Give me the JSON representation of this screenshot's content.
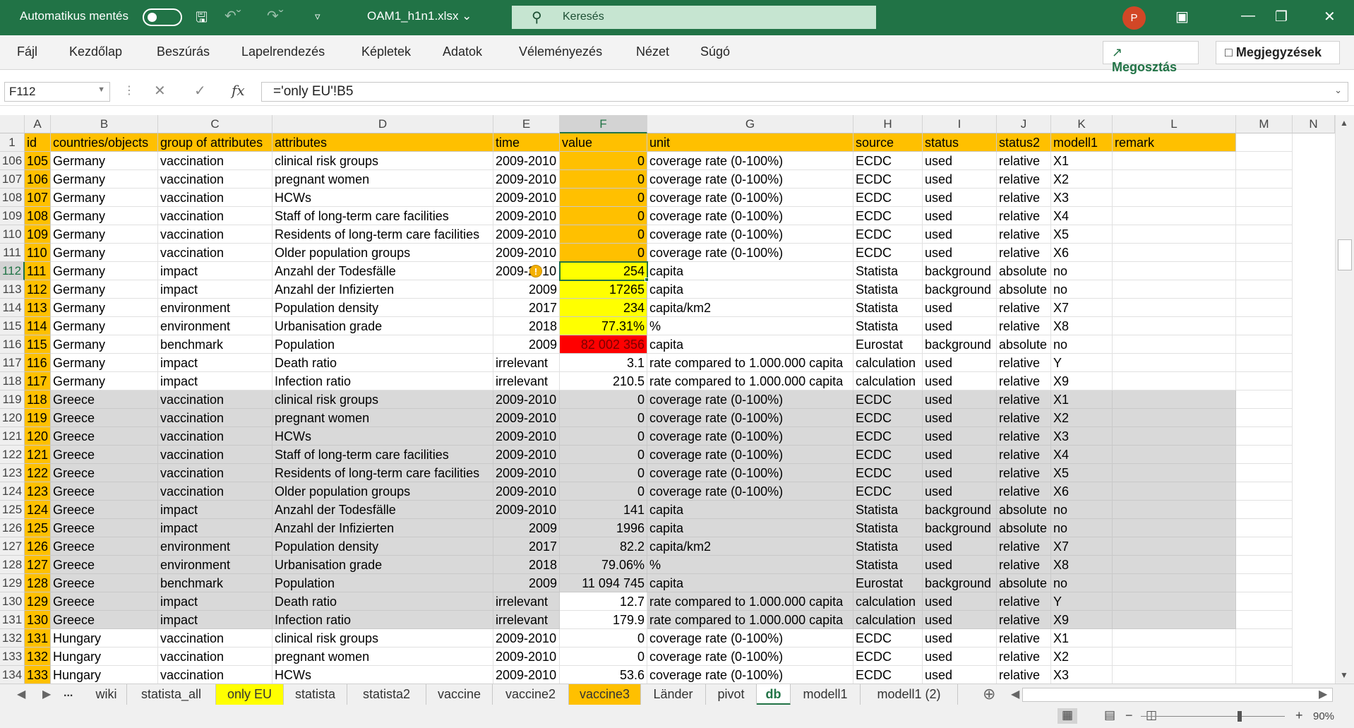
{
  "titlebar": {
    "autosave_label": "Automatikus mentés",
    "filename": "OAM1_h1n1.xlsx",
    "search_placeholder": "Keresés",
    "avatar_initial": "P"
  },
  "ribbon": {
    "tabs": [
      "Fájl",
      "Kezdőlap",
      "Beszúrás",
      "Lapelrendezés",
      "Képletek",
      "Adatok",
      "Véleményezés",
      "Nézet",
      "Súgó"
    ],
    "share_label": "Megosztás",
    "comments_label": "Megjegyzések"
  },
  "formula_bar": {
    "name_box": "F112",
    "formula": "='only EU'!B5"
  },
  "columns": [
    "A",
    "B",
    "C",
    "D",
    "E",
    "F",
    "G",
    "H",
    "I",
    "J",
    "K",
    "L",
    "M",
    "N"
  ],
  "selected_column": "F",
  "selected_row": "112",
  "header_row": {
    "row_number": "1",
    "cells": [
      "id",
      "countries/objects",
      "group of attributes",
      "attributes",
      "time",
      "value",
      "unit",
      "source",
      "status",
      "status2",
      "modell1",
      "remark"
    ]
  },
  "rows": [
    {
      "rn": "106",
      "id": "105",
      "country": "Germany",
      "group": "vaccination",
      "attr": "clinical risk groups",
      "time": "2009-2010",
      "value": "0",
      "unit": "coverage rate (0-100%)",
      "source": "ECDC",
      "status": "used",
      "status2": "relative",
      "modell1": "X1"
    },
    {
      "rn": "107",
      "id": "106",
      "country": "Germany",
      "group": "vaccination",
      "attr": "pregnant women",
      "time": "2009-2010",
      "value": "0",
      "unit": "coverage rate (0-100%)",
      "source": "ECDC",
      "status": "used",
      "status2": "relative",
      "modell1": "X2"
    },
    {
      "rn": "108",
      "id": "107",
      "country": "Germany",
      "group": "vaccination",
      "attr": "HCWs",
      "time": "2009-2010",
      "value": "0",
      "unit": "coverage rate (0-100%)",
      "source": "ECDC",
      "status": "used",
      "status2": "relative",
      "modell1": "X3"
    },
    {
      "rn": "109",
      "id": "108",
      "country": "Germany",
      "group": "vaccination",
      "attr": "Staff of long-term care facilities",
      "time": "2009-2010",
      "value": "0",
      "unit": "coverage rate (0-100%)",
      "source": "ECDC",
      "status": "used",
      "status2": "relative",
      "modell1": "X4"
    },
    {
      "rn": "110",
      "id": "109",
      "country": "Germany",
      "group": "vaccination",
      "attr": "Residents of long-term care facilities",
      "time": "2009-2010",
      "value": "0",
      "unit": "coverage rate (0-100%)",
      "source": "ECDC",
      "status": "used",
      "status2": "relative",
      "modell1": "X5"
    },
    {
      "rn": "111",
      "id": "110",
      "country": "Germany",
      "group": "vaccination",
      "attr": "Older population groups",
      "time": "2009-2010",
      "value": "0",
      "unit": "coverage rate (0-100%)",
      "source": "ECDC",
      "status": "used",
      "status2": "relative",
      "modell1": "X6"
    },
    {
      "rn": "112",
      "id": "111",
      "country": "Germany",
      "group": "impact",
      "attr": "Anzahl der Todesfälle",
      "time": "2009-2010",
      "value": "254",
      "unit": "capita",
      "source": "Statista",
      "status": "background",
      "status2": "absolute",
      "modell1": "no"
    },
    {
      "rn": "113",
      "id": "112",
      "country": "Germany",
      "group": "impact",
      "attr": "Anzahl der Infizierten",
      "time": "2009",
      "value": "17265",
      "unit": "capita",
      "source": "Statista",
      "status": "background",
      "status2": "absolute",
      "modell1": "no"
    },
    {
      "rn": "114",
      "id": "113",
      "country": "Germany",
      "group": "environment",
      "attr": "Population density",
      "time": "2017",
      "value": "234",
      "unit": "capita/km2",
      "source": "Statista",
      "status": "used",
      "status2": "relative",
      "modell1": "X7"
    },
    {
      "rn": "115",
      "id": "114",
      "country": "Germany",
      "group": "environment",
      "attr": "Urbanisation grade",
      "time": "2018",
      "value": "77.31%",
      "unit": "%",
      "source": "Statista",
      "status": "used",
      "status2": "relative",
      "modell1": "X8"
    },
    {
      "rn": "116",
      "id": "115",
      "country": "Germany",
      "group": "benchmark",
      "attr": "Population",
      "time": "2009",
      "value": "82 002 356",
      "unit": "capita",
      "source": "Eurostat",
      "status": "background",
      "status2": "absolute",
      "modell1": "no"
    },
    {
      "rn": "117",
      "id": "116",
      "country": "Germany",
      "group": "impact",
      "attr": "Death ratio",
      "time": "irrelevant",
      "value": "3.1",
      "unit": "rate compared to 1.000.000 capita",
      "source": "calculation",
      "status": "used",
      "status2": "relative",
      "modell1": "Y"
    },
    {
      "rn": "118",
      "id": "117",
      "country": "Germany",
      "group": "impact",
      "attr": "Infection ratio",
      "time": "irrelevant",
      "value": "210.5",
      "unit": "rate compared to 1.000.000 capita",
      "source": "calculation",
      "status": "used",
      "status2": "relative",
      "modell1": "X9"
    },
    {
      "rn": "119",
      "id": "118",
      "country": "Greece",
      "group": "vaccination",
      "attr": "clinical risk groups",
      "time": "2009-2010",
      "value": "0",
      "unit": "coverage rate (0-100%)",
      "source": "ECDC",
      "status": "used",
      "status2": "relative",
      "modell1": "X1"
    },
    {
      "rn": "120",
      "id": "119",
      "country": "Greece",
      "group": "vaccination",
      "attr": "pregnant women",
      "time": "2009-2010",
      "value": "0",
      "unit": "coverage rate (0-100%)",
      "source": "ECDC",
      "status": "used",
      "status2": "relative",
      "modell1": "X2"
    },
    {
      "rn": "121",
      "id": "120",
      "country": "Greece",
      "group": "vaccination",
      "attr": "HCWs",
      "time": "2009-2010",
      "value": "0",
      "unit": "coverage rate (0-100%)",
      "source": "ECDC",
      "status": "used",
      "status2": "relative",
      "modell1": "X3"
    },
    {
      "rn": "122",
      "id": "121",
      "country": "Greece",
      "group": "vaccination",
      "attr": "Staff of long-term care facilities",
      "time": "2009-2010",
      "value": "0",
      "unit": "coverage rate (0-100%)",
      "source": "ECDC",
      "status": "used",
      "status2": "relative",
      "modell1": "X4"
    },
    {
      "rn": "123",
      "id": "122",
      "country": "Greece",
      "group": "vaccination",
      "attr": "Residents of long-term care facilities",
      "time": "2009-2010",
      "value": "0",
      "unit": "coverage rate (0-100%)",
      "source": "ECDC",
      "status": "used",
      "status2": "relative",
      "modell1": "X5"
    },
    {
      "rn": "124",
      "id": "123",
      "country": "Greece",
      "group": "vaccination",
      "attr": "Older population groups",
      "time": "2009-2010",
      "value": "0",
      "unit": "coverage rate (0-100%)",
      "source": "ECDC",
      "status": "used",
      "status2": "relative",
      "modell1": "X6"
    },
    {
      "rn": "125",
      "id": "124",
      "country": "Greece",
      "group": "impact",
      "attr": "Anzahl der Todesfälle",
      "time": "2009-2010",
      "value": "141",
      "unit": "capita",
      "source": "Statista",
      "status": "background",
      "status2": "absolute",
      "modell1": "no"
    },
    {
      "rn": "126",
      "id": "125",
      "country": "Greece",
      "group": "impact",
      "attr": "Anzahl der Infizierten",
      "time": "2009",
      "value": "1996",
      "unit": "capita",
      "source": "Statista",
      "status": "background",
      "status2": "absolute",
      "modell1": "no"
    },
    {
      "rn": "127",
      "id": "126",
      "country": "Greece",
      "group": "environment",
      "attr": "Population density",
      "time": "2017",
      "value": "82.2",
      "unit": "capita/km2",
      "source": "Statista",
      "status": "used",
      "status2": "relative",
      "modell1": "X7"
    },
    {
      "rn": "128",
      "id": "127",
      "country": "Greece",
      "group": "environment",
      "attr": "Urbanisation grade",
      "time": "2018",
      "value": "79.06%",
      "unit": "%",
      "source": "Statista",
      "status": "used",
      "status2": "relative",
      "modell1": "X8"
    },
    {
      "rn": "129",
      "id": "128",
      "country": "Greece",
      "group": "benchmark",
      "attr": "Population",
      "time": "2009",
      "value": "11 094 745",
      "unit": "capita",
      "source": "Eurostat",
      "status": "background",
      "status2": "absolute",
      "modell1": "no"
    },
    {
      "rn": "130",
      "id": "129",
      "country": "Greece",
      "group": "impact",
      "attr": "Death ratio",
      "time": "irrelevant",
      "value": "12.7",
      "unit": "rate compared to 1.000.000 capita",
      "source": "calculation",
      "status": "used",
      "status2": "relative",
      "modell1": "Y"
    },
    {
      "rn": "131",
      "id": "130",
      "country": "Greece",
      "group": "impact",
      "attr": "Infection ratio",
      "time": "irrelevant",
      "value": "179.9",
      "unit": "rate compared to 1.000.000 capita",
      "source": "calculation",
      "status": "used",
      "status2": "relative",
      "modell1": "X9"
    },
    {
      "rn": "132",
      "id": "131",
      "country": "Hungary",
      "group": "vaccination",
      "attr": "clinical risk groups",
      "time": "2009-2010",
      "value": "0",
      "unit": "coverage rate (0-100%)",
      "source": "ECDC",
      "status": "used",
      "status2": "relative",
      "modell1": "X1"
    },
    {
      "rn": "133",
      "id": "132",
      "country": "Hungary",
      "group": "vaccination",
      "attr": "pregnant women",
      "time": "2009-2010",
      "value": "0",
      "unit": "coverage rate (0-100%)",
      "source": "ECDC",
      "status": "used",
      "status2": "relative",
      "modell1": "X2"
    },
    {
      "rn": "134",
      "id": "133",
      "country": "Hungary",
      "group": "vaccination",
      "attr": "HCWs",
      "time": "2009-2010",
      "value": "53.6",
      "unit": "coverage rate (0-100%)",
      "source": "ECDC",
      "status": "used",
      "status2": "relative",
      "modell1": "X3"
    }
  ],
  "colors": {
    "header_fill": "#FFC000",
    "value_orange": "#FFC000",
    "value_yellow": "#FFFF00",
    "value_red": "#FF0000",
    "greece_fill": "#D9D9D9",
    "excel_green": "#217346"
  },
  "sheet_tabs": [
    {
      "label": "wiki",
      "fill": ""
    },
    {
      "label": "statista_all",
      "fill": ""
    },
    {
      "label": "only EU",
      "fill": "#FFFF00"
    },
    {
      "label": "statista",
      "fill": ""
    },
    {
      "label": "statista2",
      "fill": ""
    },
    {
      "label": "vaccine",
      "fill": ""
    },
    {
      "label": "vaccine2",
      "fill": ""
    },
    {
      "label": "vaccine3",
      "fill": "#FFC000"
    },
    {
      "label": "Länder",
      "fill": ""
    },
    {
      "label": "pivot",
      "fill": ""
    },
    {
      "label": "db",
      "fill": "",
      "active": true
    },
    {
      "label": "modell1",
      "fill": ""
    },
    {
      "label": "modell1 (2)",
      "fill": ""
    }
  ],
  "sheet_nav_more": "...",
  "zoom": "90%"
}
